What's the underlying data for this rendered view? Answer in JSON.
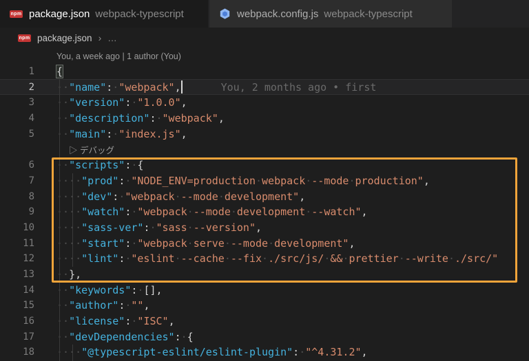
{
  "colors": {
    "editor_bg": "#1e1e1e",
    "tabbar_bg": "#232324",
    "tab_active_bg": "#1b1b1b",
    "tab_inactive_bg": "#2d2d2d",
    "tab_name_active": "#ffffff",
    "tab_name_inactive": "#aeaeae",
    "tab_desc": "#8a8a8a",
    "breadcrumb_text": "#c9c9c9",
    "breadcrumb_sep": "#8c8c8c",
    "key": "#45b2de",
    "string": "#d98c6d",
    "punct": "#d4d4d4",
    "line_number": "#7c7c7c",
    "line_number_active": "#c6c6c6",
    "whitespace_dot": "#4e4e4e",
    "annotation_box": "#f0a43a",
    "codelens": "#9c9c9c",
    "blame": "#6a6a6a",
    "current_line_bg": "#252526",
    "cursor": "#d7d7d7",
    "npm_red": "#c53635",
    "webpack_light": "#8fb6f0",
    "webpack_dark": "#4d7fd8",
    "indent_guide": "#3a3a3a"
  },
  "icons": {
    "npm_label": "npm",
    "play_glyph": "▷"
  },
  "tabs": [
    {
      "file": "package.json",
      "project": "webpack-typescript",
      "icon": "npm-icon",
      "active": true
    },
    {
      "file": "webpack.config.js",
      "project": "webpack-typescript",
      "icon": "webpack-icon",
      "active": false
    }
  ],
  "breadcrumb": {
    "file": "package.json",
    "separator": "›",
    "ellipsis": "…"
  },
  "editor": {
    "rows": [
      {
        "type": "lens",
        "text": "You, a week ago | 1 author (You)",
        "indent": 0
      },
      {
        "type": "code",
        "n": "1",
        "tokens": [
          [
            "m",
            "{"
          ]
        ]
      },
      {
        "type": "code",
        "n": "2",
        "current": true,
        "cursor": true,
        "blame": "You, 2 months ago • first",
        "tokens": [
          [
            "p",
            "  "
          ],
          [
            "k",
            "\"name\""
          ],
          [
            "p",
            ": "
          ],
          [
            "s",
            "\"webpack\""
          ],
          [
            "p",
            ","
          ]
        ]
      },
      {
        "type": "code",
        "n": "3",
        "tokens": [
          [
            "p",
            "  "
          ],
          [
            "k",
            "\"version\""
          ],
          [
            "p",
            ": "
          ],
          [
            "s",
            "\"1.0.0\""
          ],
          [
            "p",
            ","
          ]
        ]
      },
      {
        "type": "code",
        "n": "4",
        "tokens": [
          [
            "p",
            "  "
          ],
          [
            "k",
            "\"description\""
          ],
          [
            "p",
            ": "
          ],
          [
            "s",
            "\"webpack\""
          ],
          [
            "p",
            ","
          ]
        ]
      },
      {
        "type": "code",
        "n": "5",
        "tokens": [
          [
            "p",
            "  "
          ],
          [
            "k",
            "\"main\""
          ],
          [
            "p",
            ": "
          ],
          [
            "s",
            "\"index.js\""
          ],
          [
            "p",
            ","
          ]
        ]
      },
      {
        "type": "lens",
        "icon": "play",
        "text": "デバッグ",
        "indent": 2
      },
      {
        "type": "code",
        "n": "6",
        "tokens": [
          [
            "p",
            "  "
          ],
          [
            "k",
            "\"scripts\""
          ],
          [
            "p",
            ": {"
          ]
        ]
      },
      {
        "type": "code",
        "n": "7",
        "tokens": [
          [
            "p",
            "    "
          ],
          [
            "k",
            "\"prod\""
          ],
          [
            "p",
            ": "
          ],
          [
            "s",
            "\"NODE_ENV=production webpack --mode production\""
          ],
          [
            "p",
            ","
          ]
        ]
      },
      {
        "type": "code",
        "n": "8",
        "tokens": [
          [
            "p",
            "    "
          ],
          [
            "k",
            "\"dev\""
          ],
          [
            "p",
            ": "
          ],
          [
            "s",
            "\"webpack --mode development\""
          ],
          [
            "p",
            ","
          ]
        ]
      },
      {
        "type": "code",
        "n": "9",
        "tokens": [
          [
            "p",
            "    "
          ],
          [
            "k",
            "\"watch\""
          ],
          [
            "p",
            ": "
          ],
          [
            "s",
            "\"webpack --mode development --watch\""
          ],
          [
            "p",
            ","
          ]
        ]
      },
      {
        "type": "code",
        "n": "10",
        "tokens": [
          [
            "p",
            "    "
          ],
          [
            "k",
            "\"sass-ver\""
          ],
          [
            "p",
            ": "
          ],
          [
            "s",
            "\"sass --version\""
          ],
          [
            "p",
            ","
          ]
        ]
      },
      {
        "type": "code",
        "n": "11",
        "tokens": [
          [
            "p",
            "    "
          ],
          [
            "k",
            "\"start\""
          ],
          [
            "p",
            ": "
          ],
          [
            "s",
            "\"webpack serve --mode development\""
          ],
          [
            "p",
            ","
          ]
        ]
      },
      {
        "type": "code",
        "n": "12",
        "tokens": [
          [
            "p",
            "    "
          ],
          [
            "k",
            "\"lint\""
          ],
          [
            "p",
            ": "
          ],
          [
            "s",
            "\"eslint --cache --fix ./src/js/ && prettier --write ./src/\""
          ]
        ]
      },
      {
        "type": "code",
        "n": "13",
        "tokens": [
          [
            "p",
            "  },"
          ]
        ]
      },
      {
        "type": "code",
        "n": "14",
        "tokens": [
          [
            "p",
            "  "
          ],
          [
            "k",
            "\"keywords\""
          ],
          [
            "p",
            ": [],"
          ]
        ]
      },
      {
        "type": "code",
        "n": "15",
        "tokens": [
          [
            "p",
            "  "
          ],
          [
            "k",
            "\"author\""
          ],
          [
            "p",
            ": "
          ],
          [
            "s",
            "\"\""
          ],
          [
            "p",
            ","
          ]
        ]
      },
      {
        "type": "code",
        "n": "16",
        "tokens": [
          [
            "p",
            "  "
          ],
          [
            "k",
            "\"license\""
          ],
          [
            "p",
            ": "
          ],
          [
            "s",
            "\"ISC\""
          ],
          [
            "p",
            ","
          ]
        ]
      },
      {
        "type": "code",
        "n": "17",
        "tokens": [
          [
            "p",
            "  "
          ],
          [
            "k",
            "\"devDependencies\""
          ],
          [
            "p",
            ": {"
          ]
        ]
      },
      {
        "type": "code",
        "n": "18",
        "tokens": [
          [
            "p",
            "    "
          ],
          [
            "k",
            "\"@typescript-eslint/eslint-plugin\""
          ],
          [
            "p",
            ": "
          ],
          [
            "s",
            "\"^4.31.2\""
          ],
          [
            "p",
            ","
          ]
        ]
      }
    ]
  }
}
